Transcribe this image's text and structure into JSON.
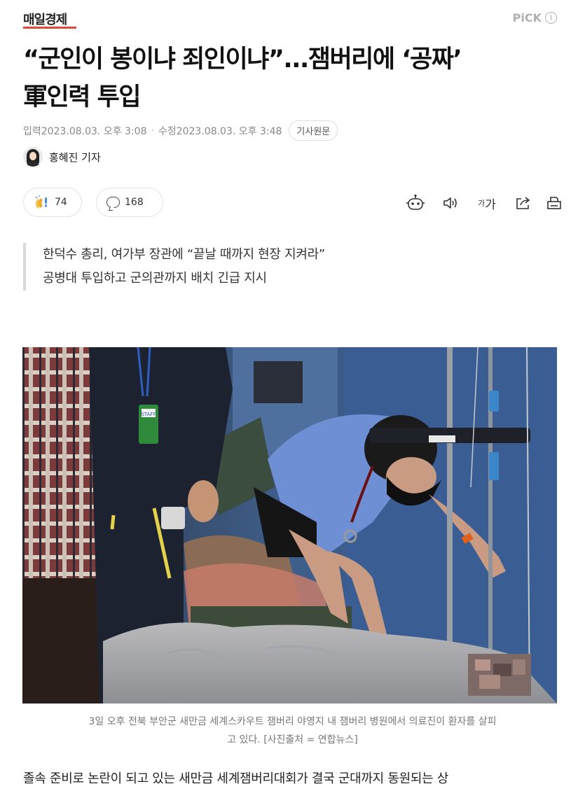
{
  "header": {
    "brand": "매일경제",
    "pick_label": "PiCK",
    "info_icon": "i"
  },
  "article": {
    "headline_line1": "“군인이 봉이냐 죄인이냐”...잼버리에 ‘공짜’",
    "headline_line2": "軍인력 투입",
    "published_label": "입력",
    "published": "2023.08.03. 오후 3:08",
    "modified_label": "수정",
    "modified": "2023.08.03. 오후 3:48",
    "original_button": "기사원문",
    "reporter": "홍혜진 기자"
  },
  "actions": {
    "reaction_count": "74",
    "comment_count": "168",
    "font_size_label": "가가",
    "icons": [
      "clap-icon",
      "comment-icon",
      "robot-summary-icon",
      "audio-icon",
      "font-size-icon",
      "share-icon",
      "print-icon"
    ]
  },
  "summary": [
    "한덕수 총리, 여가부 장관에 “끝날 때까지 현장 지켜라”",
    "공병대 투입하고 군의관까지 배치 긴급 지시"
  ],
  "photo": {
    "badge_text": "STAFF"
  },
  "caption": {
    "line1": "3일 오후 전북 부안군 새만금 세계스카우트 잼버리 야영지 내 잼버리 병원에서 의료진이 환자를 살피",
    "line2": "고 있다. [사진출처 = 연합뉴스]"
  },
  "body": {
    "first_line": "졸속 준비로 논란이 되고 있는 새만금 세계잼버리대회가 결국 군대까지 동원되는 상"
  },
  "colors": {
    "brand_underline": "#e0483e",
    "muted_text": "#888888"
  }
}
